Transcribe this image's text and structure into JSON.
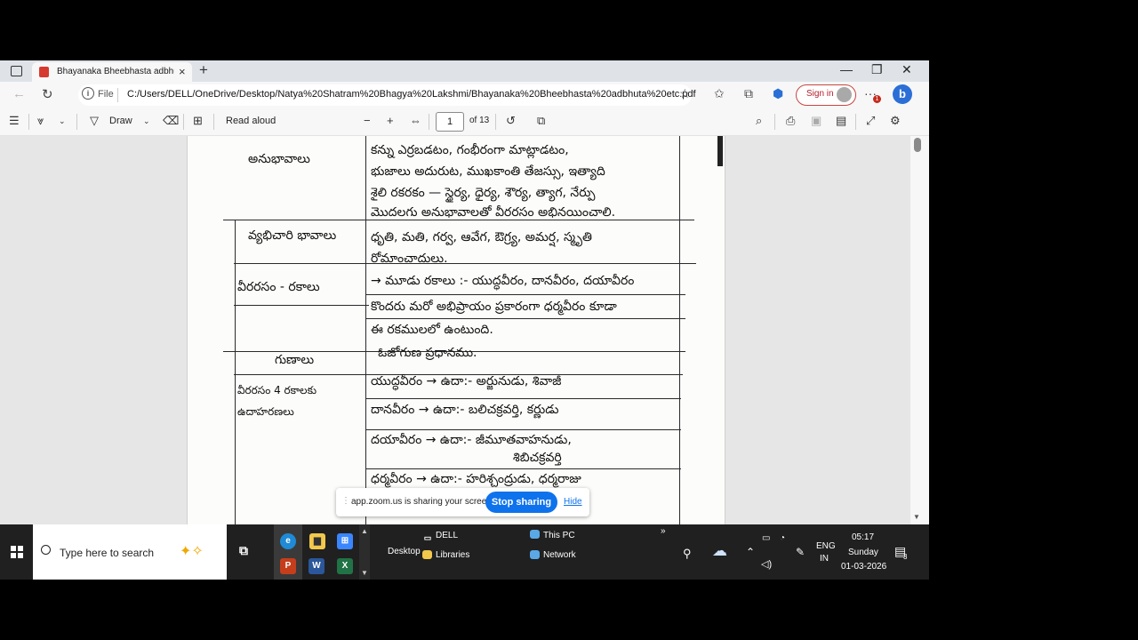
{
  "browser": {
    "tab_title": "Bhayanaka Bheebhasta adbhuta etc",
    "address_file_label": "File",
    "address_url": "C:/Users/DELL/OneDrive/Desktop/Natya%20Shatram%20Bhagya%20Lakshmi/Bhayanaka%20Bheebhasta%20adbhuta%20etc.pdf",
    "sign_in_label": "Sign in",
    "notification_badge": "1"
  },
  "pdf_toolbar": {
    "draw_label": "Draw",
    "read_aloud_label": "Read aloud",
    "current_page": "1",
    "page_count": "of 13"
  },
  "document": {
    "rows": [
      {
        "label": "అనుభావాలు",
        "lines": [
          "కన్ను ఎర్రబడటం, గంభీరంగా మాట్లాడటం,",
          "భుజాలు అదురుట, ముఖకాంతి తేజస్సు, ఇత్యాది",
          "శైలి రకరకం — స్థైర్య, ధైర్య, శౌర్య, త్యాగ, నేర్పు",
          "మొదలగు అనుభావాలతో వీరరసం అభినయించాలి."
        ]
      },
      {
        "label": "వ్యభిచారి భావాలు",
        "lines": [
          "ధృతి, మతి, గర్వ, ఆవేగ, ఔగ్ర్య, అమర్ష, స్మృతి",
          "రోమాంచాదులు."
        ]
      },
      {
        "label": "వీరరసం - రకాలు",
        "lines": [
          "→ మూడు రకాలు :- యుద్ధవీరం, దానవీరం, దయావీరం",
          "కొందరు మరో అభిప్రాయం ప్రకారంగా ధర్మవీరం కూడా",
          "ఈ రకములలో ఉంటుంది."
        ]
      },
      {
        "label": "గుణాలు",
        "lines": [
          "ఓజోగుణ ప్రధానము."
        ]
      },
      {
        "label": "వీరరసం 4 రకాలకు ఉదాహరణలు",
        "lines": [
          "యుద్ధవీరం → ఉదా:- అర్జునుడు, శివాజీ",
          "దానవీరం → ఉదా:- బలిచక్రవర్తి, కర్ణుడు",
          "దయావీరం → ఉదా:- జీమూతవాహనుడు,",
          "శిబిచక్రవర్తి",
          "ధర్మవీరం → ఉదా:- హరిశ్చంద్రుడు, ధర్మరాజు"
        ]
      }
    ]
  },
  "zoom_share": {
    "message": "app.zoom.us is sharing your screen.",
    "stop_label": "Stop sharing",
    "hide_label": "Hide"
  },
  "taskbar": {
    "search_placeholder": "Type here to search",
    "desktop_label": "Desktop",
    "items": {
      "dell": "DELL",
      "libraries": "Libraries",
      "this_pc": "This PC",
      "network": "Network"
    },
    "lang_line1": "ENG",
    "lang_line2": "IN",
    "time": "05:17",
    "day": "Sunday",
    "date": "01-03-2026",
    "notification_count": "3"
  }
}
